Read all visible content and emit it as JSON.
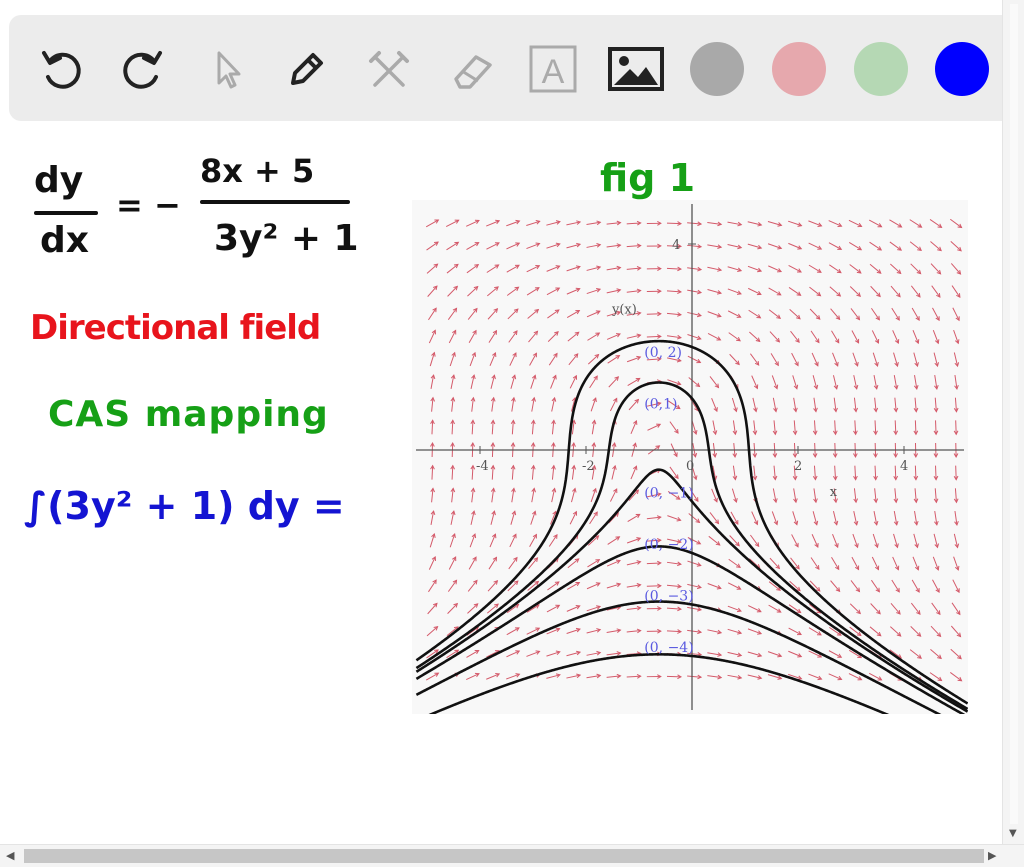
{
  "toolbar": {
    "tools": [
      {
        "name": "undo-icon"
      },
      {
        "name": "redo-icon"
      },
      {
        "name": "pointer-icon"
      },
      {
        "name": "pen-icon"
      },
      {
        "name": "tools-icon"
      },
      {
        "name": "eraser-icon"
      },
      {
        "name": "text-icon",
        "glyph": "A"
      },
      {
        "name": "image-icon"
      }
    ],
    "colors": [
      "#a9a9a9",
      "#e6a8ad",
      "#b5d8b4",
      "#0000ff"
    ]
  },
  "notes": {
    "eq_numerator_left": "dy",
    "eq_denominator_left": "dx",
    "eq_equals": "= −",
    "eq_numerator_right": "8x + 5",
    "eq_denominator_right": "3y² + 1",
    "fig_label": "fig 1",
    "directional": "Directional field",
    "cas": "CAS mapping",
    "integral": "∫(3y² + 1) dy ="
  },
  "ink_colors": {
    "black": "#111111",
    "red": "#e8141c",
    "green": "#16a016",
    "blue": "#1414d2"
  },
  "chart_data": {
    "type": "line",
    "title": "",
    "xlabel": "x",
    "ylabel": "y(x)",
    "xlim": [
      -5,
      5
    ],
    "ylim": [
      -4.5,
      4.5
    ],
    "x_ticks": [
      "-4",
      "-2",
      "0",
      "2",
      "4"
    ],
    "y_ticks": [
      "4"
    ],
    "field_color": "#d45a6a",
    "curve_color": "#111111",
    "label_color": "#5a5ae0",
    "series": [
      {
        "name": "(0, 2)",
        "initial": [
          0,
          2
        ]
      },
      {
        "name": "(0,1)",
        "initial": [
          0,
          1
        ]
      },
      {
        "name": "(0, −1)",
        "initial": [
          0,
          -1
        ]
      },
      {
        "name": "(0, −2)",
        "initial": [
          0,
          -2
        ]
      },
      {
        "name": "(0, −3)",
        "initial": [
          0,
          -3
        ]
      },
      {
        "name": "(0, −4)",
        "initial": [
          0,
          -4
        ]
      }
    ]
  }
}
